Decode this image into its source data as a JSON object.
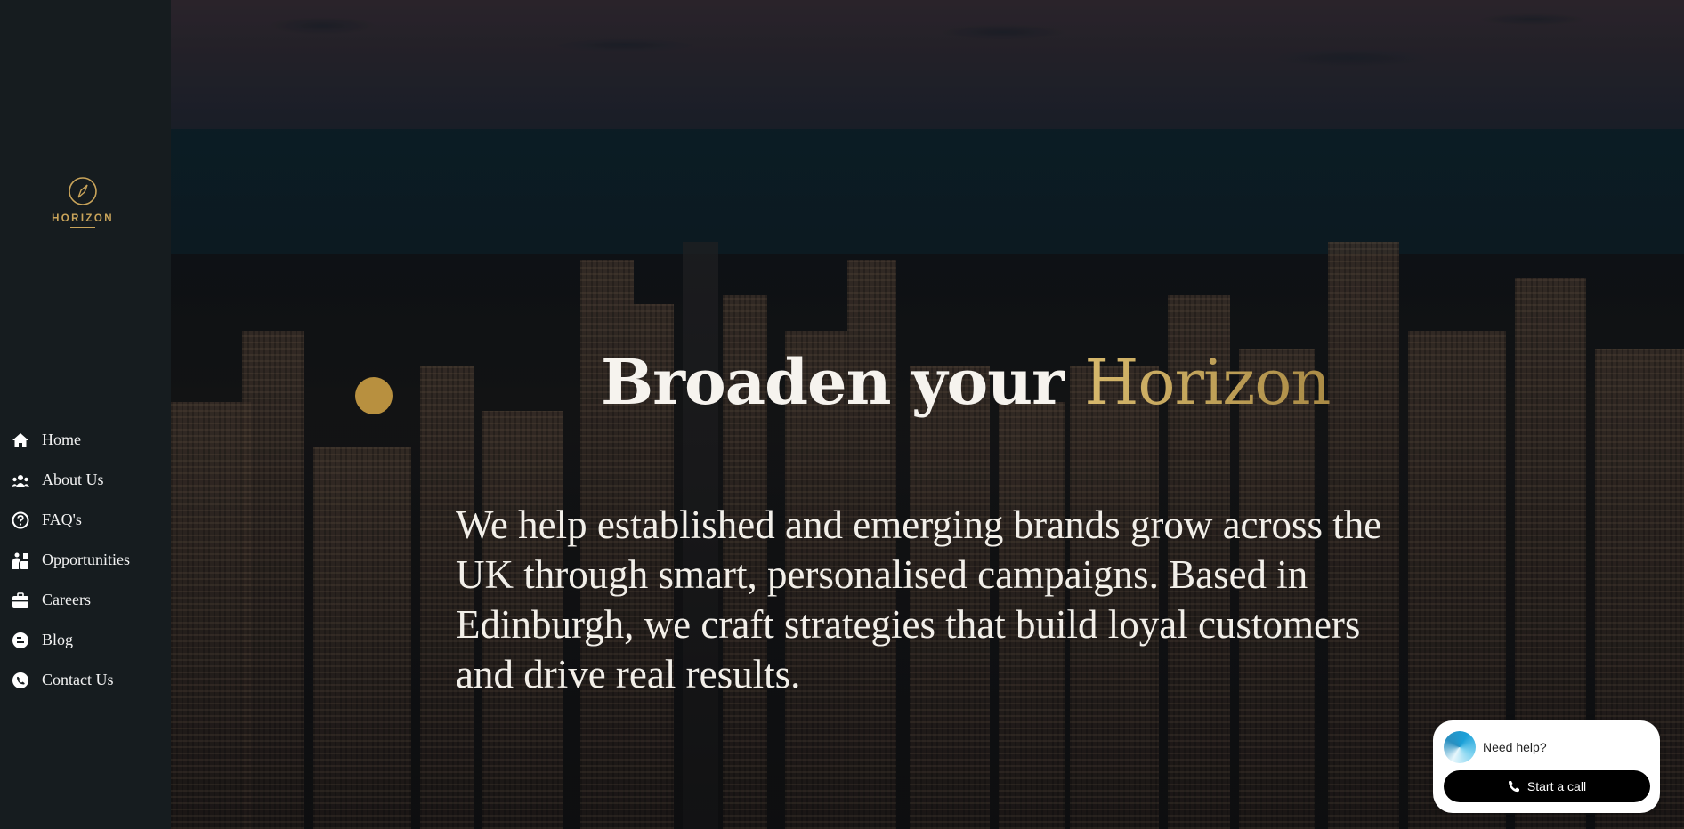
{
  "brand": {
    "name": "HORIZON"
  },
  "nav": {
    "items": [
      {
        "label": "Home",
        "icon": "home-icon"
      },
      {
        "label": "About Us",
        "icon": "users-icon"
      },
      {
        "label": "FAQ's",
        "icon": "question-icon"
      },
      {
        "label": "Opportunities",
        "icon": "opportunities-icon"
      },
      {
        "label": "Careers",
        "icon": "briefcase-icon"
      },
      {
        "label": "Blog",
        "icon": "blog-icon"
      },
      {
        "label": "Contact Us",
        "icon": "contact-icon"
      }
    ]
  },
  "hero": {
    "headline_part1": "Broaden your ",
    "headline_part2": "Horizon",
    "lead": "We help established and emerging brands grow across the UK through smart, personalised campaigns. Based in Edinburgh, we craft strategies that build loyal customers and drive real results."
  },
  "chat": {
    "prompt": "Need help?",
    "button_label": "Start a call"
  },
  "colors": {
    "sidebar": "#161c1f",
    "gold": "#c9a45a",
    "accent_dot": "#b8903f"
  }
}
